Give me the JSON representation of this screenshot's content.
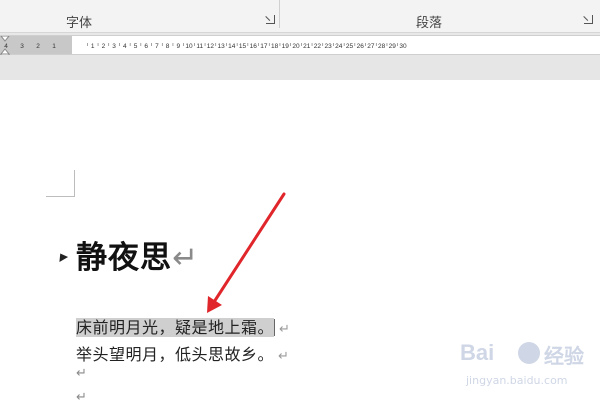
{
  "ribbon": {
    "groups": [
      {
        "label": "字体"
      },
      {
        "label": "段落"
      }
    ]
  },
  "ruler": {
    "left_ticks": [
      "4",
      "3",
      "2",
      "1"
    ],
    "ticks": [
      "1",
      "2",
      "3",
      "4",
      "5",
      "6",
      "7",
      "8",
      "9",
      "10",
      "11",
      "12",
      "13",
      "14",
      "15",
      "16",
      "17",
      "18",
      "19",
      "20",
      "21",
      "22",
      "23",
      "24",
      "25",
      "26",
      "27",
      "28",
      "29",
      "30"
    ]
  },
  "document": {
    "title": "静夜思",
    "paragraph_mark": "↵",
    "line1_highlighted": "床前明月光，疑是地上霜",
    "line1_end": "。",
    "line2": "举头望明月，低头思故乡。"
  },
  "watermark": {
    "logo": "Bai",
    "logo2": "经验",
    "url": "jingyan.baidu.com"
  },
  "colors": {
    "arrow": "#e0262b",
    "highlight": "#cfcfcf"
  }
}
